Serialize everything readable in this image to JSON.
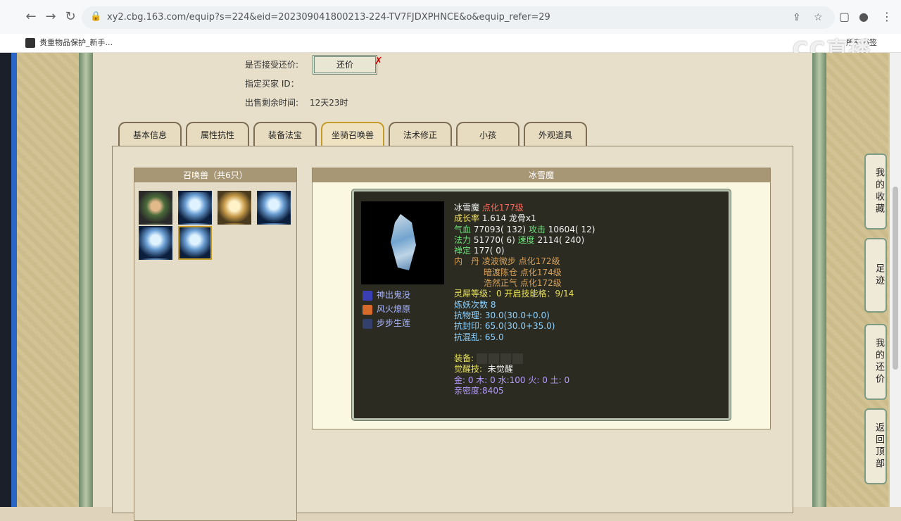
{
  "browser": {
    "url": "xy2.cbg.163.com/equip?s=224&eid=202309041800213-224-TV7FJDXPHNCE&o&equip_refer=29",
    "bookmark_item": "贵重物品保护_新手...",
    "bookmark_right": "所有书签"
  },
  "watermark": "CC直播",
  "top_info": {
    "counter_offer_label": "是否接受还价:",
    "counter_offer_button": "还价",
    "buyer_id_label": "指定买家 ID：",
    "time_left_label": "出售剩余时间:",
    "time_left_value": "12天23时"
  },
  "tabs": [
    "基本信息",
    "属性抗性",
    "装备法宝",
    "坐骑召唤兽",
    "法术修正",
    "小孩",
    "外观道具"
  ],
  "pet_list": {
    "header": "召唤兽（共6只）"
  },
  "detail": {
    "header": "冰雪魔",
    "name": "冰雪魔",
    "level": "点化177级",
    "growth_label": "成长率",
    "growth_value": "1.614",
    "bone": "龙骨x1",
    "hp_label": "气血",
    "hp_value": "77093( 132)",
    "atk_label": "攻击",
    "atk_value": "10604( 12)",
    "mp_label": "法力",
    "mp_value": "51770( 6)",
    "spd_label": "速度",
    "spd_value": "2114( 240)",
    "focus_label": "禅定",
    "focus_value": "177( 0)",
    "neidan_label": "内　丹",
    "neidan_1": "凌波微步 点化172级",
    "neidan_2": "暗渡陈仓 点化174级",
    "neidan_3": "浩然正气 点化172级",
    "lingxi": "灵犀等级：0 开启技能格：9/14",
    "refine": "炼妖次数 8",
    "res_phys": "抗物理: 30.0(30.0+0.0)",
    "res_seal": "抗封印: 65.0(30.0+35.0)",
    "res_chaos": "抗混乱: 65.0",
    "equip_label": "装备:",
    "awaken_label": "觉醒技:",
    "awaken_value": "未觉醒",
    "elements": "金: 0 木: 0 水:100 火: 0 土: 0",
    "intimacy": "亲密度:8405",
    "skills": [
      "神出鬼没",
      "风火燎原",
      "步步生莲"
    ]
  },
  "side_buttons": [
    "我的收藏",
    "足迹",
    "我的还价",
    "返回顶部"
  ]
}
